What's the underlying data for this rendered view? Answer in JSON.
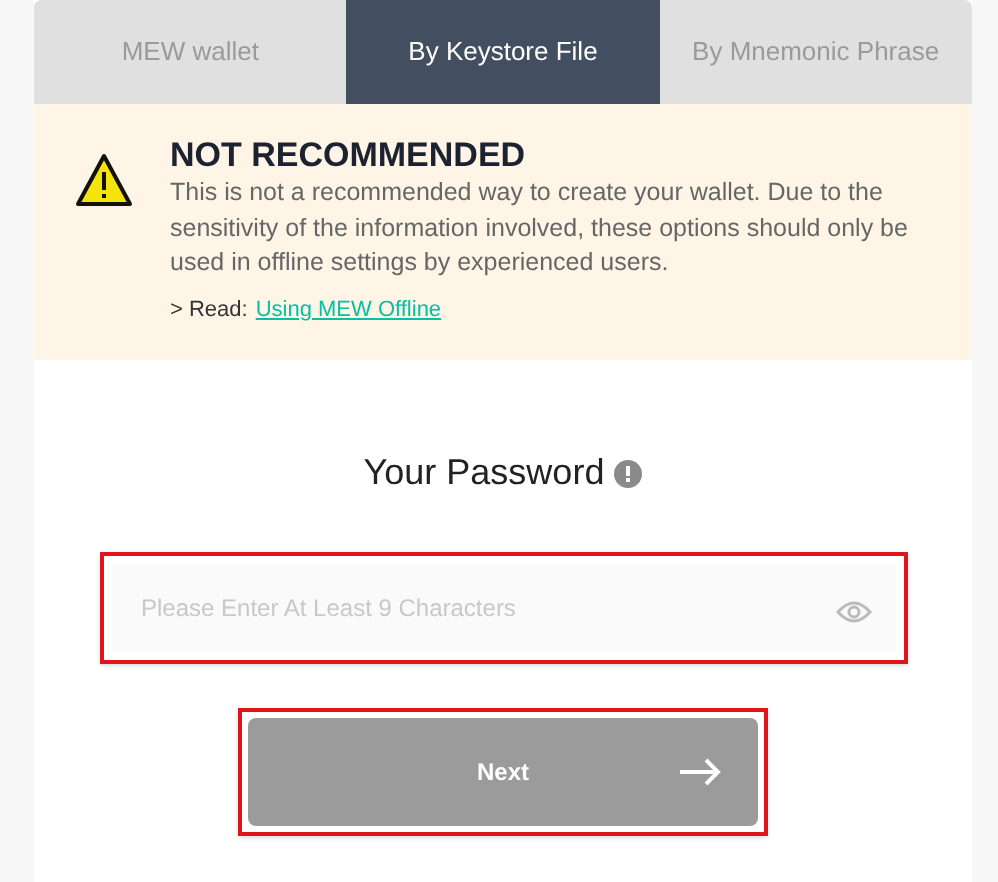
{
  "tabs": [
    {
      "label": "MEW wallet",
      "selected": false
    },
    {
      "label": "By Keystore File",
      "selected": true
    },
    {
      "label": "By Mnemonic Phrase",
      "selected": false
    }
  ],
  "warning": {
    "title": "NOT RECOMMENDED",
    "body": "This is not a recommended way to create your wallet. Due to the sensitivity of the information involved, these options should only be used in offline settings by experienced users.",
    "read_prefix": "> Read:",
    "read_link": "Using MEW Offline"
  },
  "password": {
    "title": "Your Password",
    "placeholder": "Please Enter At Least 9 Characters",
    "highlighted": true
  },
  "next_button": {
    "label": "Next",
    "disabled": true,
    "highlighted": true
  }
}
